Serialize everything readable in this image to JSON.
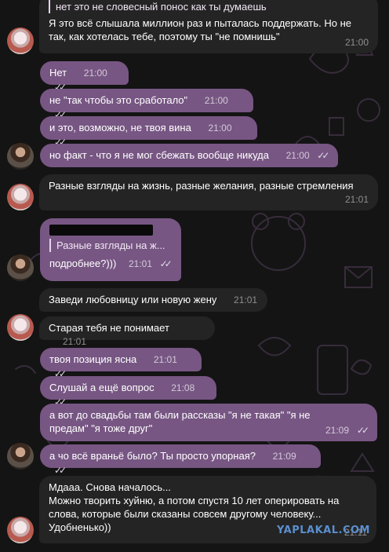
{
  "messages": [
    {
      "reply_quote": "нет это не словесный понос как ты думаешь",
      "text": "Я это всё слышала миллион раз и пыталась поддержать. Но не так, как хотелась тебе, поэтому ты \"не помнишь\"",
      "time": "21:00"
    },
    {
      "text": "Нет",
      "time": "21:00"
    },
    {
      "text": "не \"так чтобы это сработало\"",
      "time": "21:00"
    },
    {
      "text": "и это, возможно, не твоя вина",
      "time": "21:00"
    },
    {
      "text": "но факт - что я не мог сбежать вообще никуда",
      "time": "21:00"
    },
    {
      "text": "Разные взгляды на жизнь, разные желания, разные стремления",
      "time": "21:01"
    },
    {
      "reply_quote": "Разные взгляды на ж...",
      "text": "подробнее?)))",
      "time": "21:01"
    },
    {
      "text": "Заведи любовницу или новую жену",
      "time": "21:01"
    },
    {
      "text": "Старая тебя не понимает",
      "time": "21:01"
    },
    {
      "text": "твоя позиция ясна",
      "time": "21:01"
    },
    {
      "text": "Слушай а ещё вопрос",
      "time": "21:08"
    },
    {
      "text": "а вот до свадьбы там были рассказы \"я не такая\" \"я не предам\" \"я тоже друг\"",
      "time": "21:09"
    },
    {
      "text": "а чо всё враньё было? Ты просто упорная?",
      "time": "21:09"
    },
    {
      "text": "Мдааа. Снова началось...\nМожно творить хуйню, а потом спустя 10 лет оперировать на слова, которые были сказаны совсем другому человеку...\nУдобненько))",
      "time": "21:11"
    }
  ],
  "watermark": "YAPLAKAL.COM",
  "icons": {
    "read": "double-check-icon"
  }
}
